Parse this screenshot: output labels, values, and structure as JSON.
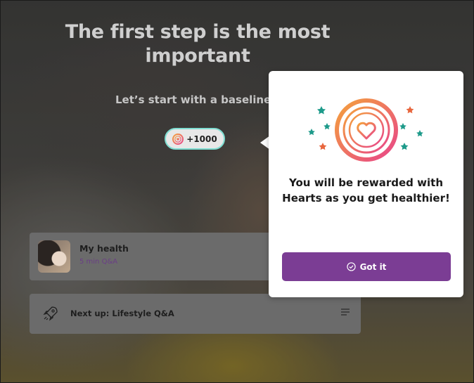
{
  "intro": {
    "title": "The first step is the most important",
    "subtitle": "Let’s start with a baseline",
    "points_badge": "+1000"
  },
  "cards": [
    {
      "title": "My health",
      "subtitle": "5 min Q&A",
      "icon": "avatar-photo"
    },
    {
      "title": "Next up: Lifestyle Q&A",
      "icon": "rocket-icon",
      "action_icon": "menu-icon"
    }
  ],
  "popover": {
    "message": "You will be rewarded with Hearts as you get healthier!",
    "button_label": "Got it",
    "button_icon": "check-circle-icon"
  },
  "colors": {
    "accent_purple": "#7b3d94",
    "teal": "#7fded2",
    "heart_gradient_start": "#f4a23b",
    "heart_gradient_end": "#e8458a",
    "star_teal": "#1d9a8a",
    "star_orange": "#e8663d"
  }
}
